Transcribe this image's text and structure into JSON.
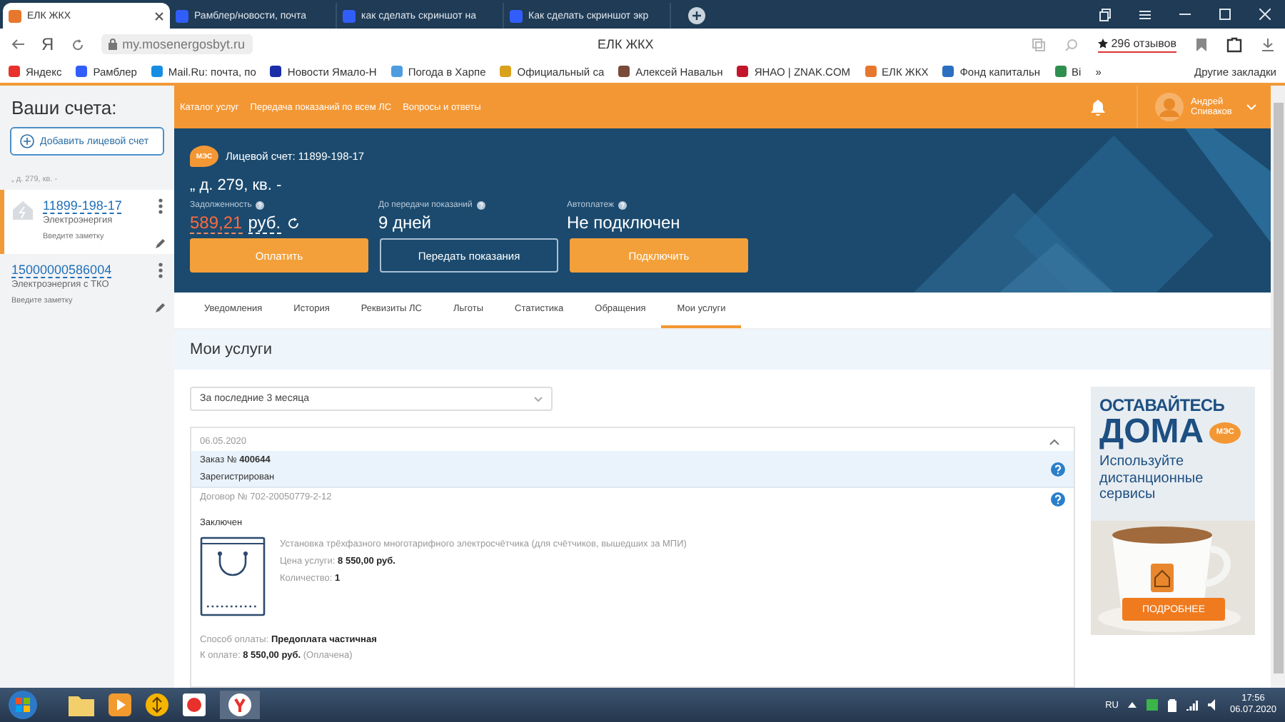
{
  "browser": {
    "tabs": [
      {
        "title": "ЕЛК ЖКХ",
        "selected": true
      },
      {
        "title": "Рамблер/новости, почта",
        "selected": false
      },
      {
        "title": "как сделать скриншот на",
        "selected": false
      },
      {
        "title": "Как сделать скриншот экр",
        "selected": false
      }
    ],
    "home_glyph": "Я",
    "url": "my.mosenergosbyt.ru",
    "page_title": "ЕЛК ЖКХ",
    "reviews": "296 отзывов",
    "bookmarks": [
      {
        "label": "Яндекс",
        "color": "#e8312b"
      },
      {
        "label": "Рамблер",
        "color": "#315efb"
      },
      {
        "label": "Mail.Ru: почта, по",
        "color": "#168de2"
      },
      {
        "label": "Новости Ямало-Н",
        "color": "#1a2ea8"
      },
      {
        "label": "Погода в Харпе",
        "color": "#4d9de0"
      },
      {
        "label": "Официальный са",
        "color": "#d9a21b"
      },
      {
        "label": "Алексей Навальн",
        "color": "#7a4a3a"
      },
      {
        "label": "ЯНАО | ZNAK.COM",
        "color": "#c4162a"
      },
      {
        "label": "ЕЛК ЖКХ",
        "color": "#e8772e"
      },
      {
        "label": "Фонд капитальн",
        "color": "#2a6fc0"
      },
      {
        "label": "Ві",
        "color": "#2f8f4e"
      }
    ],
    "more": "»",
    "other_bookmarks": "Другие закладки"
  },
  "sidebar": {
    "title": "Ваши счета:",
    "add_button": "Добавить лицевой счет",
    "address": "„ д. 279, кв. -",
    "accounts": [
      {
        "number": "11899-198-17",
        "service": "Электроэнергия",
        "note_placeholder": "Введите заметку",
        "selected": true
      },
      {
        "number": "15000000586004",
        "service": "Электроэнергия с ТКО",
        "note_placeholder": "Введите заметку",
        "selected": false
      }
    ]
  },
  "nav": {
    "links": [
      "Каталог услуг",
      "Передача показаний по всем ЛС",
      "Вопросы и ответы"
    ],
    "user_first": "Андрей",
    "user_last": "Спиваков"
  },
  "hero": {
    "logo": "МЭС",
    "account": "Лицевой счет: 11899-198-17",
    "address": "„ д. 279, кв. -",
    "stats": [
      {
        "label": "Задолженность",
        "value": "589,21",
        "unit": "руб.",
        "kind": "debt"
      },
      {
        "label": "До передачи показаний",
        "value": "9 дней",
        "kind": "plain"
      },
      {
        "label": "Автоплатеж",
        "value": "Не подключен",
        "kind": "plain"
      }
    ],
    "buttons": [
      {
        "label": "Оплатить",
        "kind": "primary"
      },
      {
        "label": "Передать показания",
        "kind": "outline"
      },
      {
        "label": "Подключить",
        "kind": "primary"
      }
    ]
  },
  "tabs": [
    {
      "label": "Уведомления",
      "selected": false
    },
    {
      "label": "История",
      "selected": false
    },
    {
      "label": "Реквизиты ЛС",
      "selected": false
    },
    {
      "label": "Льготы",
      "selected": false
    },
    {
      "label": "Статистика",
      "selected": false
    },
    {
      "label": "Обращения",
      "selected": false
    },
    {
      "label": "Мои услуги",
      "selected": true
    }
  ],
  "section_title": "Мои услуги",
  "period_select": "За последние 3 месяца",
  "orders": [
    {
      "date": "06.05.2020",
      "expanded": true,
      "order": "Заказ № **400644**",
      "order_status": "Зарегистрирован",
      "contract": "Договор № 702-20050779-2-12",
      "contract_status": "Заключен",
      "service": "Установка трёхфазного многотарифного электросчётчика (для счётчиков, вышедших за МПИ)",
      "price": "Цена услуги: **8 550,00 руб.**",
      "quantity": "Количество: **1**",
      "payment_method": "Способ оплаты: **Предоплата частичная**",
      "to_pay": "К оплате: **8 550,00 руб.** (Оплачена)"
    }
  ],
  "ad": {
    "line1": "ОСТАВАЙТЕСЬ",
    "line2": "ДОМА",
    "logo": "МЭС",
    "subtitle": "Используйте дистанционные сервисы",
    "button": "ПОДРОБНЕЕ"
  },
  "taskbar": {
    "language": "RU",
    "time": "17:56",
    "date": "06.07.2020"
  }
}
